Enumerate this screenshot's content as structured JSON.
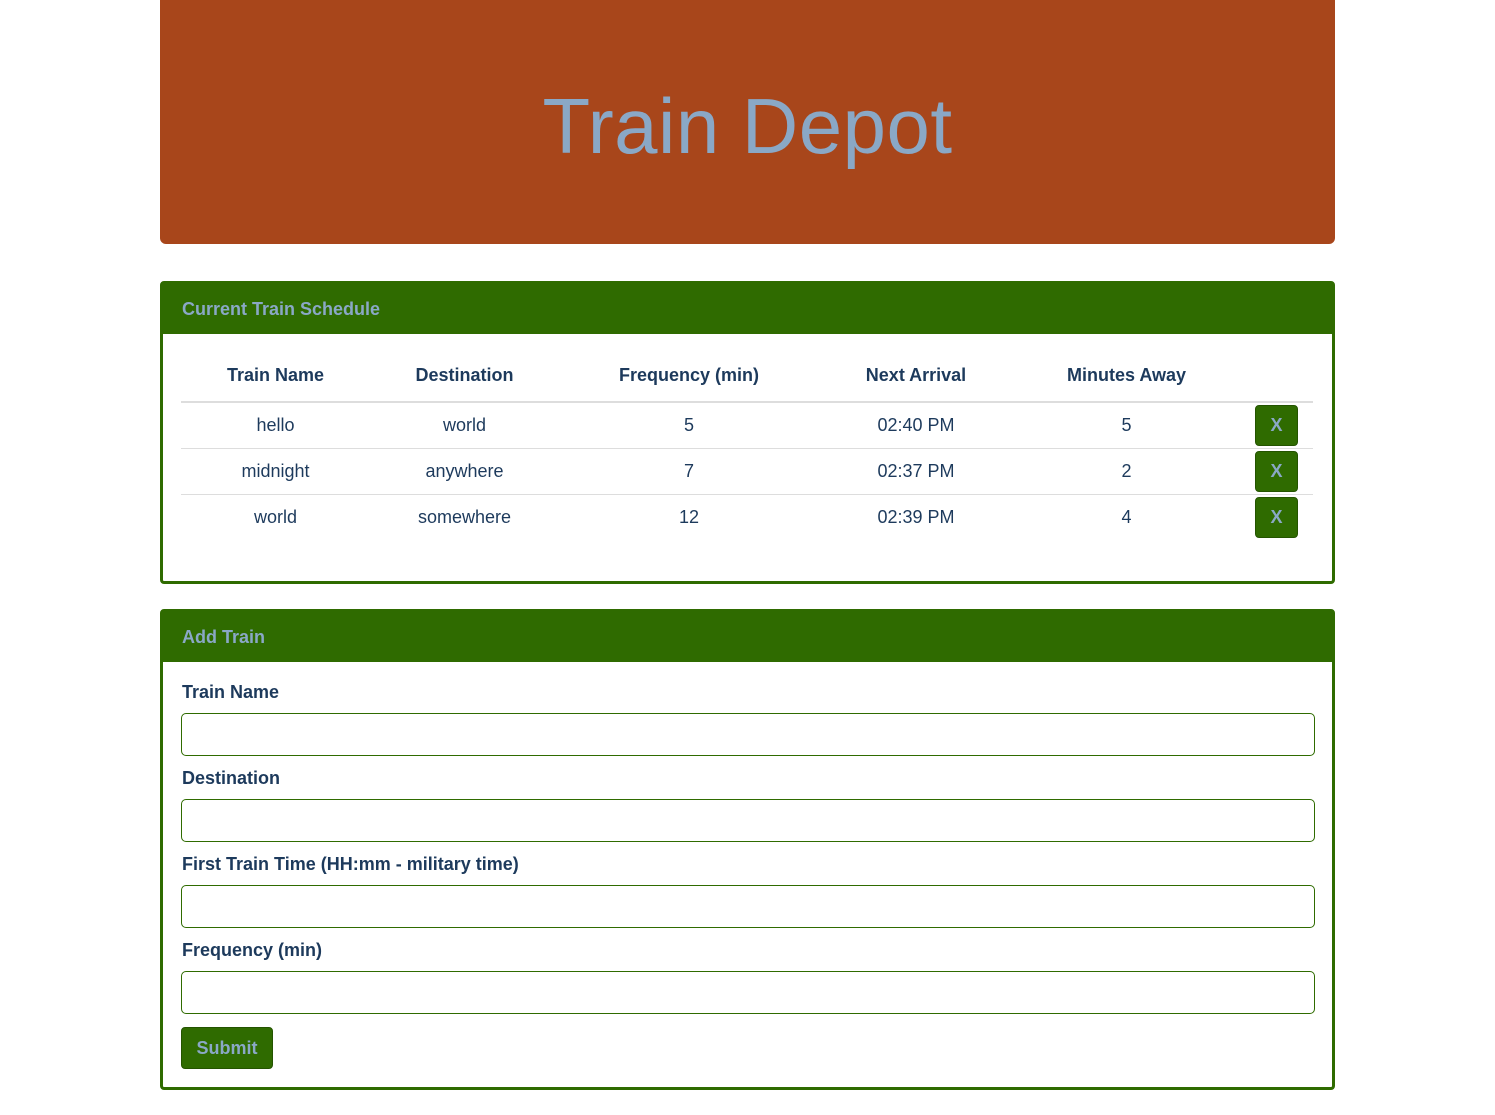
{
  "header": {
    "title": "Train Depot"
  },
  "schedule": {
    "title": "Current Train Schedule",
    "columns": [
      "Train Name",
      "Destination",
      "Frequency (min)",
      "Next Arrival",
      "Minutes Away"
    ],
    "rows": [
      {
        "name": "hello",
        "destination": "world",
        "frequency": "5",
        "next_arrival": "02:40 PM",
        "minutes_away": "5",
        "delete_label": "X"
      },
      {
        "name": "midnight",
        "destination": "anywhere",
        "frequency": "7",
        "next_arrival": "02:37 PM",
        "minutes_away": "2",
        "delete_label": "X"
      },
      {
        "name": "world",
        "destination": "somewhere",
        "frequency": "12",
        "next_arrival": "02:39 PM",
        "minutes_away": "4",
        "delete_label": "X"
      }
    ]
  },
  "add_train": {
    "title": "Add Train",
    "fields": [
      {
        "label": "Train Name",
        "value": ""
      },
      {
        "label": "Destination",
        "value": ""
      },
      {
        "label": "First Train Time (HH:mm - military time)",
        "value": ""
      },
      {
        "label": "Frequency (min)",
        "value": ""
      }
    ],
    "submit_label": "Submit"
  },
  "colors": {
    "header_bg": "#a8461b",
    "title_text": "#8aa8c6",
    "panel_green": "#2f6b00",
    "body_text": "#1d3a5c"
  }
}
